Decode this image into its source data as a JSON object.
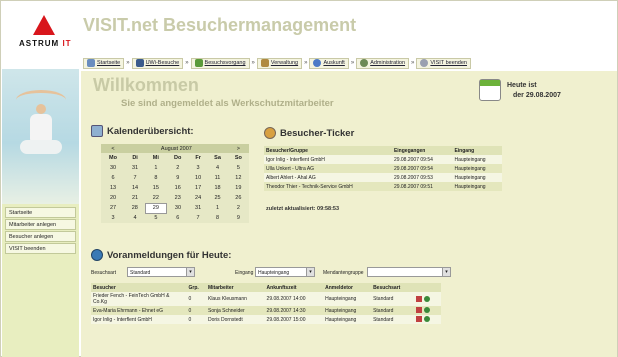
{
  "logo": {
    "text_main": "ASTRUM",
    "text_accent": "IT"
  },
  "app_title": "VISIT.net Besuchermanagement",
  "nav": {
    "items": [
      {
        "label": "Startseite",
        "icon": "home-icon"
      },
      {
        "label": "UWi-Besuche",
        "icon": "car-icon"
      },
      {
        "label": "Besuchsvorgang",
        "icon": "people-icon"
      },
      {
        "label": "Verwaltung",
        "icon": "gear-icon"
      },
      {
        "label": "Auskunft",
        "icon": "info-icon"
      },
      {
        "label": "Administration",
        "icon": "admin-icon"
      },
      {
        "label": "VISIT beenden",
        "icon": "exit-icon"
      }
    ],
    "separator": "»"
  },
  "sidebar": {
    "items": [
      {
        "label": "Startseite"
      },
      {
        "label": "Mitarbeiter anlegen"
      },
      {
        "label": "Besucher anlegen"
      },
      {
        "label": "VISIT beenden"
      }
    ]
  },
  "welcome": {
    "title": "Willkommen",
    "subtitle": "Sie sind angemeldet als Werkschutzmitarbeiter"
  },
  "today": {
    "label": "Heute ist",
    "date": "der 29.08.2007"
  },
  "calendar": {
    "title": "Kalenderübersicht:",
    "prev": "<",
    "next": ">",
    "month": "August 2007",
    "weekdays": [
      "Mo",
      "Di",
      "Mi",
      "Do",
      "Fr",
      "Sa",
      "So"
    ],
    "weeks": [
      [
        "30",
        "31",
        "1",
        "2",
        "3",
        "4",
        "5"
      ],
      [
        "6",
        "7",
        "8",
        "9",
        "10",
        "11",
        "12"
      ],
      [
        "13",
        "14",
        "15",
        "16",
        "17",
        "18",
        "19"
      ],
      [
        "20",
        "21",
        "22",
        "23",
        "24",
        "25",
        "26"
      ],
      [
        "27",
        "28",
        "29",
        "30",
        "31",
        "1",
        "2"
      ],
      [
        "3",
        "4",
        "5",
        "6",
        "7",
        "8",
        "9"
      ]
    ],
    "highlight": "29"
  },
  "ticker": {
    "title": "Besucher-Ticker",
    "columns": [
      "Besucher/Gruppe",
      "Eingegangen",
      "Eingang"
    ],
    "rows": [
      [
        "Igor Inlig - Interflent GmbH",
        "29.08.2007 09:54",
        "Haupteingang"
      ],
      [
        "Ulla Unkert - Ultra AG",
        "29.08.2007 09:54",
        "Haupteingang"
      ],
      [
        "Albert Ahlert - Ahal AG",
        "29.08.2007 09:53",
        "Haupteingang"
      ],
      [
        "Theodor Thier - Technik-Service GmbH",
        "29.08.2007 09:51",
        "Haupteingang"
      ]
    ],
    "updated": "zuletzt aktualisiert: 09:58:53"
  },
  "preregistrations": {
    "title": "Voranmeldungen für Heute:",
    "filters": {
      "visit_type_label": "Besuchsart",
      "visit_type_value": "Standard",
      "entrance_label": "Eingang",
      "entrance_value": "Haupteingang",
      "group_label": "Mendantengruppe",
      "group_value": ""
    },
    "columns": [
      "Besucher",
      "Grp.",
      "Mitarbeiter",
      "Ankunftszeit",
      "Anmeldetor",
      "Besuchsart"
    ],
    "rows": [
      [
        "Frieder Fench - FeinTech GmbH & Co.Kg",
        "0",
        "Klaus Kleusmann",
        "29.08.2007 14:00",
        "Haupteingang",
        "Standard"
      ],
      [
        "Eva-Maria Ehrmann - Ehnet eG",
        "0",
        "Sonja Schneider",
        "29.08.2007 14:30",
        "Haupteingang",
        "Standard"
      ],
      [
        "Igor Inlig - Interflent GmbH",
        "0",
        "Doris Dornstedt",
        "29.08.2007 15:00",
        "Haupteingang",
        "Standard"
      ]
    ]
  },
  "colors": {
    "accent_red": "#d8161c",
    "panel_bg": "#f0f0cf",
    "title_muted": "#c9cbaa"
  }
}
